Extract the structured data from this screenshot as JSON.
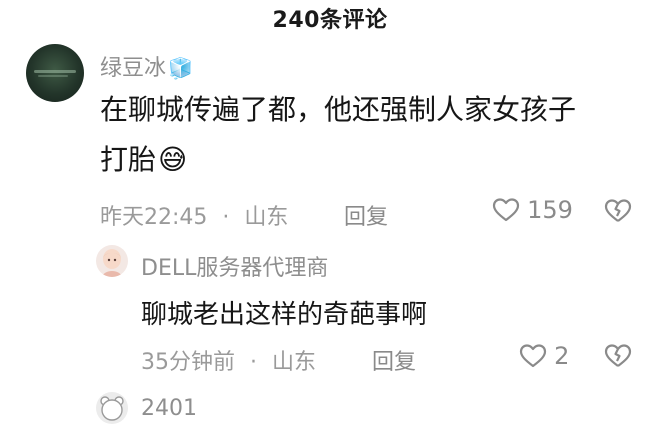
{
  "header": {
    "title": "240条评论"
  },
  "comments": [
    {
      "user": "绿豆冰",
      "user_emoji": "🧊",
      "text_line1": "在聊城传遍了都，他还强制人家女孩子",
      "text_line2": "打胎",
      "text_emoji": "😅",
      "time": "昨天22:45",
      "separator": "·",
      "location": "山东",
      "reply_label": "回复",
      "likes": "159",
      "avatar_icon": "green-photo-avatar"
    }
  ],
  "replies": [
    {
      "user": "DELL服务器代理商",
      "text": "聊城老出这样的奇葩事啊",
      "time": "35分钟前",
      "separator": "·",
      "location": "山东",
      "reply_label": "回复",
      "likes": "2",
      "avatar_icon": "doll-avatar"
    }
  ],
  "next_comment": {
    "user": "2401",
    "avatar_icon": "bear-avatar"
  },
  "colors": {
    "text_primary": "#161616",
    "text_secondary": "#8e8e8e",
    "background": "#ffffff"
  }
}
